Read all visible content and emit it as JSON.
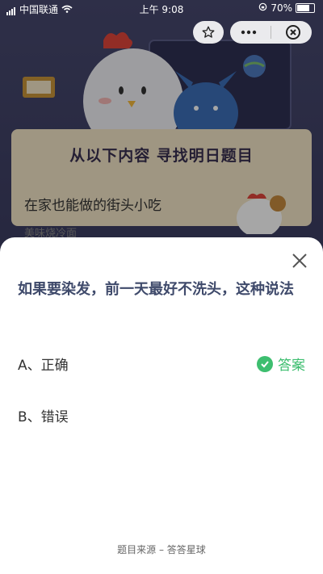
{
  "status": {
    "carrier": "中国联通",
    "time": "上午 9:08",
    "battery": "70%"
  },
  "banner": {
    "title": "从以下内容  寻找明日题目",
    "item": "在家也能做的街头小吃",
    "sub": "美味烧冷面"
  },
  "quiz": {
    "question": "如果要染发，前一天最好不洗头，这种说法",
    "options": [
      {
        "label": "A、正确"
      },
      {
        "label": "B、错误"
      }
    ],
    "answer_label": "答案",
    "footer": "题目来源 – 答答星球"
  }
}
